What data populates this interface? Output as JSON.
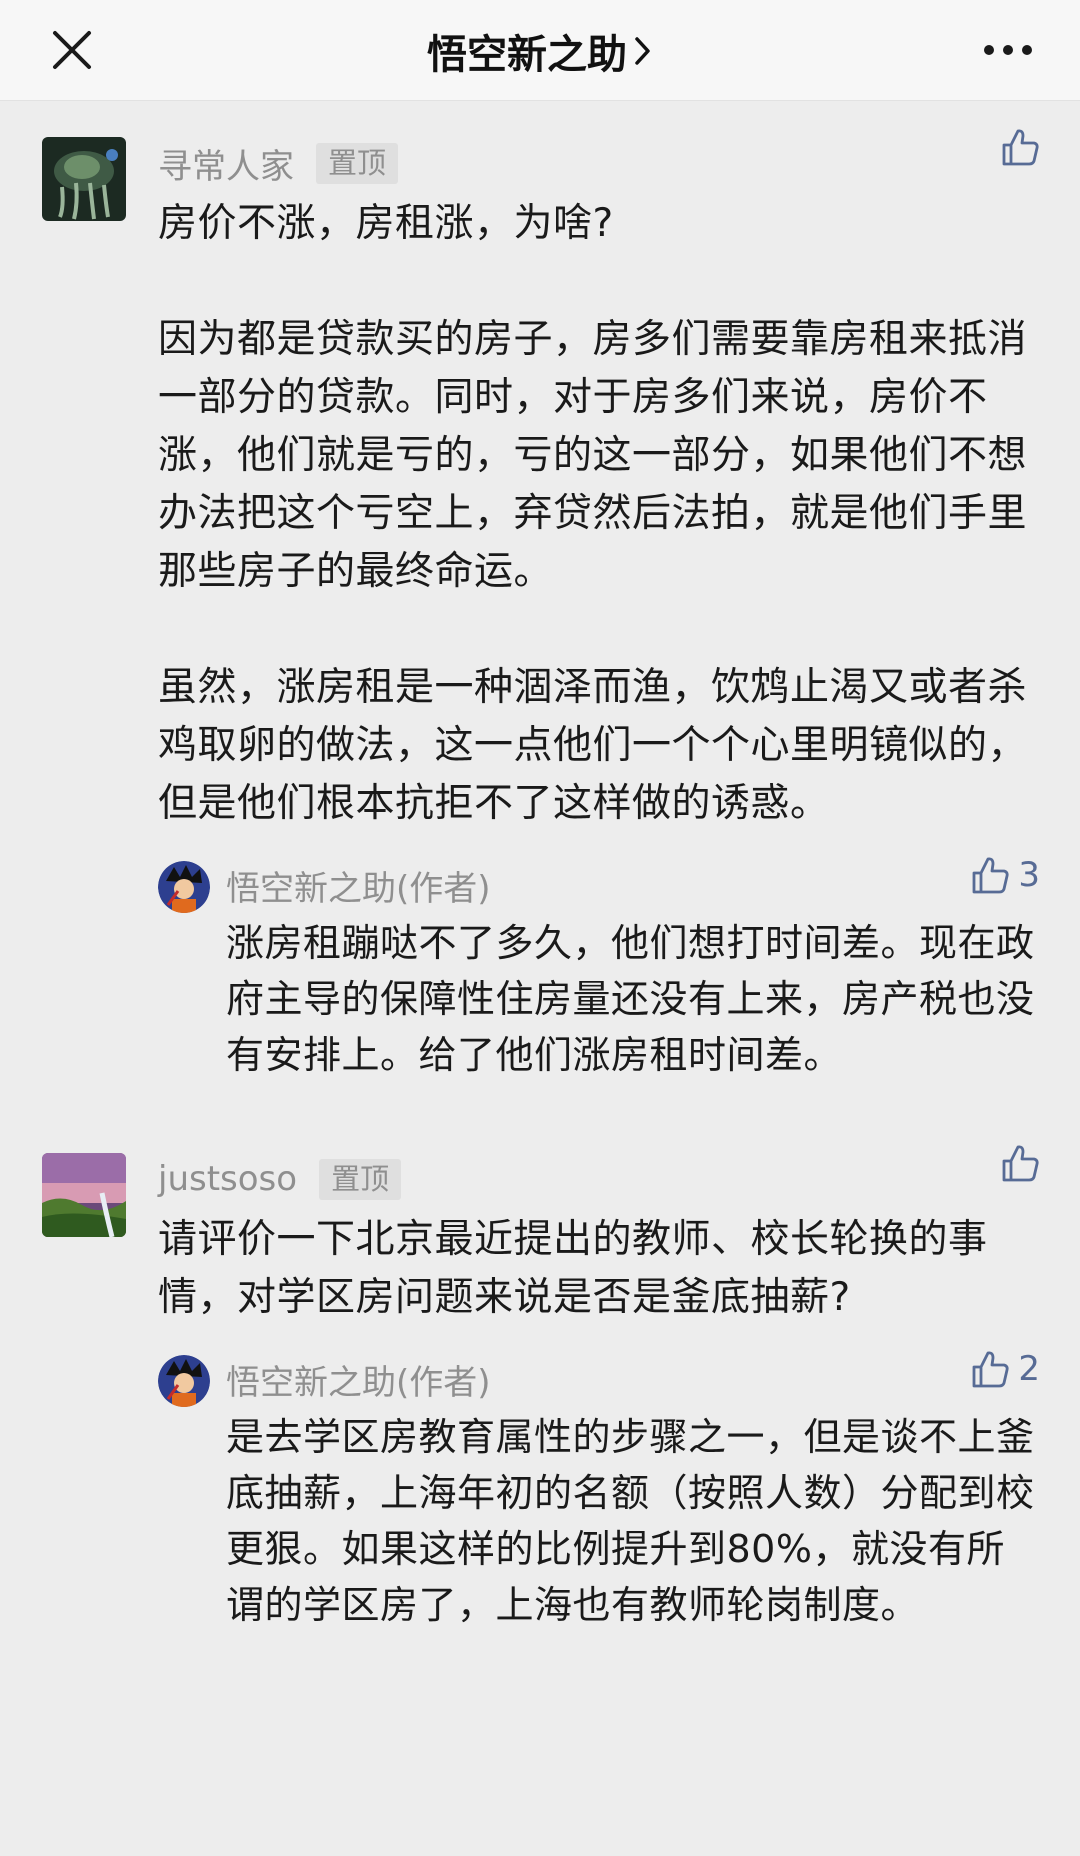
{
  "header": {
    "title": "悟空新之助",
    "title_arrow": ">",
    "close_icon": "close-icon",
    "more_icon": "more-dots-icon"
  },
  "comments": [
    {
      "author": "寻常人家",
      "badge": "置顶",
      "like_icon": "thumbs-up-icon",
      "paragraphs": [
        "房价不涨，房租涨，为啥?",
        "因为都是贷款买的房子，房多们需要靠房租来抵消一部分的贷款。同时，对于房多们来说，房价不涨，他们就是亏的，亏的这一部分，如果他们不想办法把这个亏空上，弃贷然后法拍，就是他们手里那些房子的最终命运。",
        "虽然，涨房租是一种涸泽而渔，饮鸩止渴又或者杀鸡取卵的做法，这一点他们一个个心里明镜似的，但是他们根本抗拒不了这样做的诱惑。"
      ],
      "reply": {
        "author": "悟空新之助(作者)",
        "likes": "3",
        "text": "涨房租蹦哒不了多久，他们想打时间差。现在政府主导的保障性住房量还没有上来，房产税也没有安排上。给了他们涨房租时间差。"
      }
    },
    {
      "author": "justsoso",
      "badge": "置顶",
      "like_icon": "thumbs-up-icon",
      "paragraphs": [
        "请评价一下北京最近提出的教师、校长轮换的事情，对学区房问题来说是否是釜底抽薪?"
      ],
      "reply": {
        "author": "悟空新之助(作者)",
        "likes": "2",
        "text": "是去学区房教育属性的步骤之一，但是谈不上釜底抽薪，上海年初的名额（按照人数）分配到校更狠。如果这样的比例提升到80%，就没有所谓的学区房了，上海也有教师轮岗制度。"
      }
    }
  ],
  "colors": {
    "background": "#ededed",
    "header_bg": "#f7f7f7",
    "name_gray": "#8f8f8f",
    "like_blue": "#576b95",
    "text": "#1a1a1a"
  }
}
